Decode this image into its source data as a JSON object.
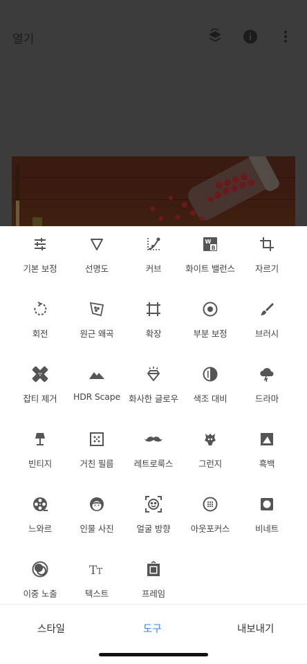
{
  "header": {
    "open_label": "열기",
    "icons": [
      "layers-undo-icon",
      "info-icon",
      "more-vert-icon"
    ]
  },
  "tools": [
    {
      "label": "기본 보정",
      "icon": "tune-sliders-icon"
    },
    {
      "label": "선명도",
      "icon": "details-triangle-icon"
    },
    {
      "label": "커브",
      "icon": "curves-icon"
    },
    {
      "label": "화이트 밸런스",
      "icon": "white-balance-icon"
    },
    {
      "label": "자르기",
      "icon": "crop-icon"
    },
    {
      "label": "회전",
      "icon": "rotate-icon"
    },
    {
      "label": "원근 왜곡",
      "icon": "perspective-icon"
    },
    {
      "label": "확장",
      "icon": "expand-icon"
    },
    {
      "label": "부분 보정",
      "icon": "selective-icon"
    },
    {
      "label": "브러시",
      "icon": "brush-icon"
    },
    {
      "label": "잡티 제거",
      "icon": "healing-bandage-icon"
    },
    {
      "label": "HDR Scape",
      "icon": "mountains-icon"
    },
    {
      "label": "화사한 글로우",
      "icon": "glamour-glow-icon"
    },
    {
      "label": "색조 대비",
      "icon": "tonal-contrast-icon"
    },
    {
      "label": "드라마",
      "icon": "drama-cloud-icon"
    },
    {
      "label": "빈티지",
      "icon": "vintage-lamp-icon"
    },
    {
      "label": "거친 필름",
      "icon": "grainy-film-icon"
    },
    {
      "label": "레트로룩스",
      "icon": "mustache-icon"
    },
    {
      "label": "그런지",
      "icon": "grunge-icon"
    },
    {
      "label": "흑백",
      "icon": "black-white-icon"
    },
    {
      "label": "느와르",
      "icon": "film-reel-icon"
    },
    {
      "label": "인물 사진",
      "icon": "portrait-face-icon"
    },
    {
      "label": "얼굴 방향",
      "icon": "head-pose-icon"
    },
    {
      "label": "아웃포커스",
      "icon": "lens-blur-icon"
    },
    {
      "label": "비네트",
      "icon": "vignette-icon"
    },
    {
      "label": "이중 노출",
      "icon": "double-exposure-icon"
    },
    {
      "label": "텍스트",
      "icon": "text-icon"
    },
    {
      "label": "프레임",
      "icon": "frame-icon"
    }
  ],
  "bottom_nav": {
    "styles_label": "스타일",
    "tools_label": "도구",
    "export_label": "내보내기",
    "active": "tools"
  },
  "colors": {
    "accent": "#3b82f0",
    "icon": "#555555",
    "label": "#444444",
    "backdrop": "#3c3c3c"
  }
}
